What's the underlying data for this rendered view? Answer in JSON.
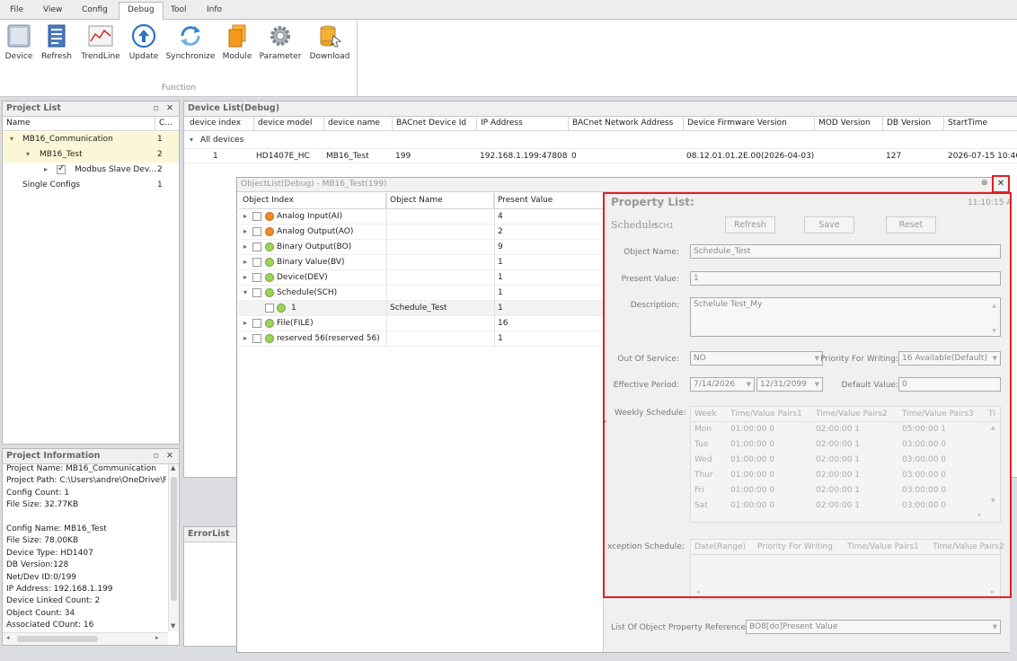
{
  "menu": {
    "items": [
      "File",
      "View",
      "Config",
      "Debug",
      "Tool",
      "Info"
    ],
    "active": "Debug"
  },
  "ribbon": {
    "buttons": [
      {
        "label": "Device",
        "icon": "device-icon"
      },
      {
        "label": "Refresh",
        "icon": "refresh-icon"
      },
      {
        "label": "TrendLine",
        "icon": "trendline-icon"
      },
      {
        "label": "Update",
        "icon": "update-icon"
      },
      {
        "label": "Synchronize",
        "icon": "synchronize-icon"
      },
      {
        "label": "Module",
        "icon": "module-icon"
      },
      {
        "label": "Parameter",
        "icon": "gear-icon"
      },
      {
        "label": "Download",
        "icon": "download-icon"
      }
    ],
    "group_label": "Function"
  },
  "project_list": {
    "title": "Project List",
    "col_name": "Name",
    "col_count": "C...",
    "rows": [
      {
        "name": "MB16_Communication",
        "count": "1"
      },
      {
        "name": "MB16_Test",
        "count": "2"
      },
      {
        "name": "Modbus Slave Dev...",
        "count": "2"
      },
      {
        "name": "Single Configs",
        "count": "1"
      }
    ]
  },
  "project_info": {
    "title": "Project Information",
    "lines": [
      "Project Name: MB16_Communication",
      "Project Path: C:\\Users\\andre\\OneDrive\\P",
      "Config Count: 1",
      "File Size: 32.77KB",
      "",
      "Config Name: MB16_Test",
      "File Size: 78.00KB",
      "Device Type: HD1407",
      "DB Version:128",
      "Net/Dev ID:0/199",
      "IP Address: 192.168.1.199",
      "Device Linked Count: 2",
      "Object Count: 34",
      "Associated COunt: 16"
    ]
  },
  "device_list": {
    "title": "Device List(Debug)",
    "columns": [
      "device index",
      "device model",
      "device name",
      "BACnet Device Id",
      "IP Address",
      "BACnet Network Address",
      "Device Firmware Version",
      "MOD Version",
      "DB Version",
      "StartTime"
    ],
    "group": "All devices",
    "row": [
      "1",
      "HD1407E_HC",
      "MB16_Test",
      "199",
      "192.168.1.199:47808",
      "0",
      "08.12.01.01.2E.00(2026-04-03)",
      "",
      "127",
      "2026-07-15 10:46"
    ]
  },
  "error_list": {
    "title": "ErrorList"
  },
  "object_list": {
    "title": "ObjectList(Debug) - MB16_Test(199)",
    "columns": [
      "Object Index",
      "Object Name",
      "Present Value"
    ],
    "rows": [
      {
        "index": "Analog Input(AI)",
        "name": "",
        "value": "4"
      },
      {
        "index": "Analog Output(AO)",
        "name": "",
        "value": "2"
      },
      {
        "index": "Binary Output(BO)",
        "name": "",
        "value": "9"
      },
      {
        "index": "Binary Value(BV)",
        "name": "",
        "value": "1"
      },
      {
        "index": "Device(DEV)",
        "name": "",
        "value": "1"
      },
      {
        "index": "Schedule(SCH)",
        "name": "",
        "value": "1"
      },
      {
        "index": "1",
        "name": "Schedule_Test",
        "value": "1"
      },
      {
        "index": "File(FILE)",
        "name": "",
        "value": "16"
      },
      {
        "index": "reserved 56(reserved 56)",
        "name": "",
        "value": "1"
      }
    ],
    "colors": {
      "orange": "#f08a2a",
      "green": "#9cd45a"
    }
  },
  "property": {
    "title": "Property List:",
    "time": "11:10:15 A",
    "schedule_label": "Schedule",
    "schedule_sub": "SCH1",
    "refresh": "Refresh",
    "save": "Save",
    "reset": "Reset",
    "object_name_label": "Object Name:",
    "object_name": "Schedule_Test",
    "present_value_label": "Present Value:",
    "present_value": "1",
    "description_label": "Description:",
    "description": "Schelule Test_My",
    "out_of_service_label": "Out Of Service:",
    "out_of_service": "NO",
    "priority_label": "Priority For Writing:",
    "priority": "16 Available(Default)",
    "effective_label": "Effective Period:",
    "effective_from": "7/14/2026",
    "effective_to": "12/31/2099",
    "default_label": "Default Value:",
    "default_value": "0",
    "weekly_label": "Weekly Schedule:",
    "weekly_cols": [
      "Week",
      "Time/Value Pairs1",
      "Time/Value Pairs2",
      "Time/Value Pairs3",
      "Ti"
    ],
    "weekly_rows": [
      [
        "Mon",
        "01:00:00 0",
        "02:00:00 1",
        "05:00:00 1"
      ],
      [
        "Tue",
        "01:00:00 0",
        "02:00:00 1",
        "03:00:00 0"
      ],
      [
        "Wed",
        "01:00:00 0",
        "02:00:00 1",
        "03:00:00 0"
      ],
      [
        "Thur",
        "01:00:00 0",
        "02:00:00 1",
        "03:00:00 0"
      ],
      [
        "Fri",
        "01:00:00 0",
        "02:00:00 1",
        "03:00:00 0"
      ],
      [
        "Sat",
        "01:00:00 0",
        "02:00:00 1",
        "03:00:00 0"
      ]
    ],
    "exception_label": "xception Schedule:",
    "exception_cols": [
      "Date(Range)",
      "Priority For Writing",
      "Time/Value Pairs1",
      "Time/Value Pairs2"
    ],
    "refs_label": "List Of Object Property References:",
    "refs_value": "BO8[do]Present Value",
    "highlight_color": "#e02020"
  }
}
